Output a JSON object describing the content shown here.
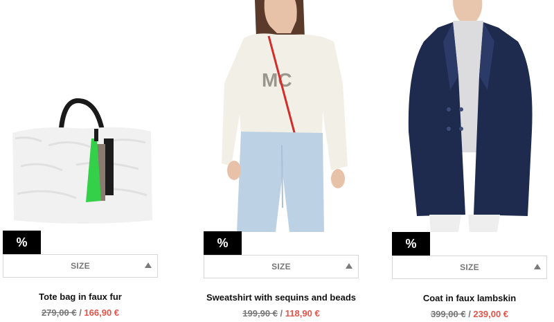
{
  "colors": {
    "sale_price": "#e2534a",
    "old_price": "#777777",
    "badge_bg": "#000000"
  },
  "products": [
    {
      "name": "Tote bag in faux fur",
      "badge": "%",
      "size_label": "SIZE",
      "old_price": "279,00 €",
      "separator": "/",
      "new_price": "166,90 €",
      "image_icon": "tote-bag-image"
    },
    {
      "name": "Sweatshirt with sequins and beads",
      "badge": "%",
      "size_label": "SIZE",
      "old_price": "199,90 €",
      "separator": "/",
      "new_price": "118,90 €",
      "image_icon": "sweatshirt-model-image"
    },
    {
      "name": "Coat in faux lambskin",
      "badge": "%",
      "size_label": "SIZE",
      "old_price": "399,00 €",
      "separator": "/",
      "new_price": "239,00 €",
      "image_icon": "coat-model-image"
    }
  ]
}
